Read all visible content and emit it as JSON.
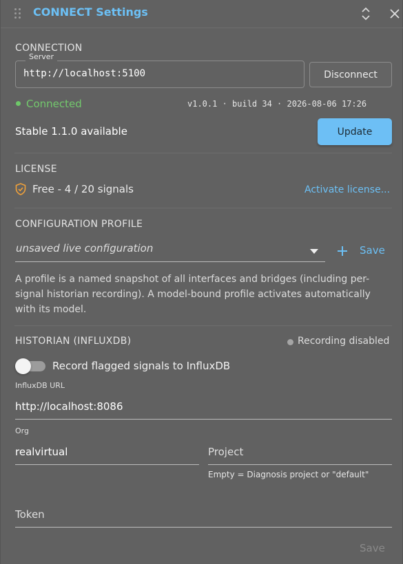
{
  "header": {
    "title": "CONNECT Settings",
    "drag_icon": "drag-handle-icon",
    "expand_icon": "unfold-icon",
    "close_icon": "close-icon"
  },
  "connection": {
    "section_label": "CONNECTION",
    "server_label": "Server",
    "server_value": "http://localhost:5100",
    "disconnect_label": "Disconnect",
    "status": "Connected",
    "status_color": "#6ec869",
    "version_info": "v1.0.1 · build 34 · 2026-08-06 17:26",
    "update_text": "Stable 1.1.0 available",
    "update_label": "Update"
  },
  "license": {
    "section_label": "LICENSE",
    "status": "Free - 4 / 20 signals",
    "activate_label": "Activate license..."
  },
  "profile": {
    "section_label": "CONFIGURATION PROFILE",
    "selected": "unsaved live configuration",
    "save_label": "Save",
    "description": "A profile is a named snapshot of all interfaces and bridges (including per-signal historian recording). A model-bound profile activates automatically with its model."
  },
  "historian": {
    "section_label": "HISTORIAN (INFLUXDB)",
    "recording_status": "Recording disabled",
    "toggle_label": "Record flagged signals to InfluxDB",
    "toggle_on": false,
    "url_label": "InfluxDB URL",
    "url_value": "http://localhost:8086",
    "org_label": "Org",
    "org_value": "realvirtual",
    "project_placeholder": "Project",
    "project_helper": "Empty = Diagnosis project or \"default\"",
    "token_placeholder": "Token",
    "save_label": "Save"
  },
  "colors": {
    "accent": "#6cc0f5",
    "background": "#616161",
    "license_icon": "#f0a13a"
  }
}
